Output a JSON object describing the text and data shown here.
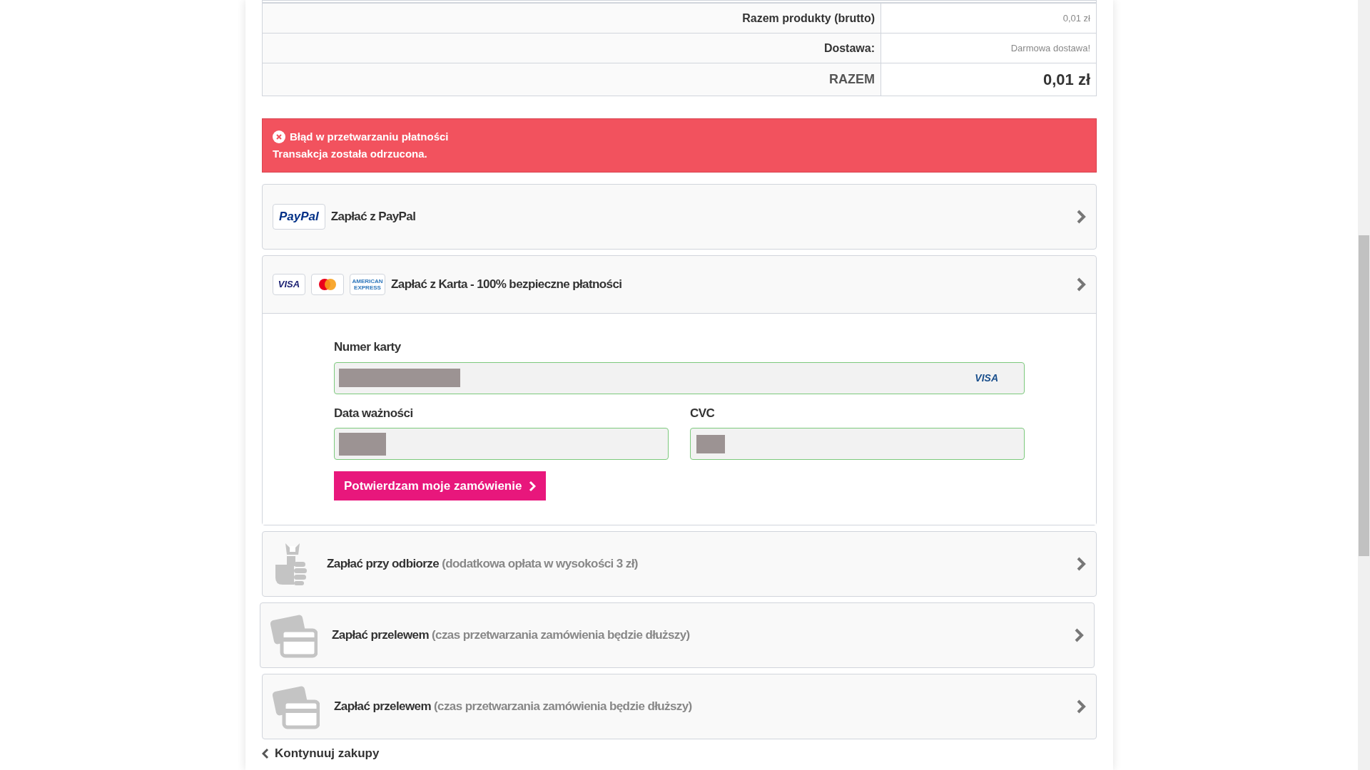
{
  "totals": [
    {
      "label": "Razem produkty (brutto)",
      "value": "0,01 zł",
      "kind": "normal"
    },
    {
      "label": "Dostawa:",
      "value": "Darmowa dostawa!",
      "kind": "normal"
    },
    {
      "label": "RAZEM",
      "value": "0,01 zł",
      "kind": "grand"
    }
  ],
  "alert": {
    "title": "Błąd w przetwarzaniu płatności",
    "message": "Transakcja została odrzucona."
  },
  "methods": [
    {
      "kind": "paypal",
      "label": "Zapłać z PayPal",
      "expanded": false,
      "logos": [
        {
          "kind": "paypal",
          "text": "PayPal"
        }
      ]
    },
    {
      "kind": "card",
      "label": "Zapłać z Karta - 100% bezpieczne płatności",
      "expanded": true,
      "logos": [
        {
          "kind": "visa",
          "text": "VISA"
        },
        {
          "kind": "mastercard"
        },
        {
          "kind": "amex",
          "text": "AMERICAN EXPRESS"
        }
      ]
    },
    {
      "kind": "cod",
      "label": "Zapłać przy odbiorze",
      "note": "(dodatkowa opłata w wysokości 3 zł)",
      "expanded": false
    },
    {
      "kind": "transfer",
      "label": "Zapłać przelewem",
      "note": "(czas przetwarzania zamówienia będzie dłuższy)",
      "expanded": false
    },
    {
      "kind": "transfer",
      "label": "Zapłać przelewem",
      "note": "(czas przetwarzania zamówienia będzie dłuższy)",
      "expanded": false
    }
  ],
  "card_form": {
    "number_label": "Numer karty",
    "brand": "VISA",
    "expiry_label": "Data ważności",
    "cvc_label": "CVC",
    "submit": "Potwierdzam moje zamówienie"
  },
  "continue_link": "Kontynuuj zakupy"
}
